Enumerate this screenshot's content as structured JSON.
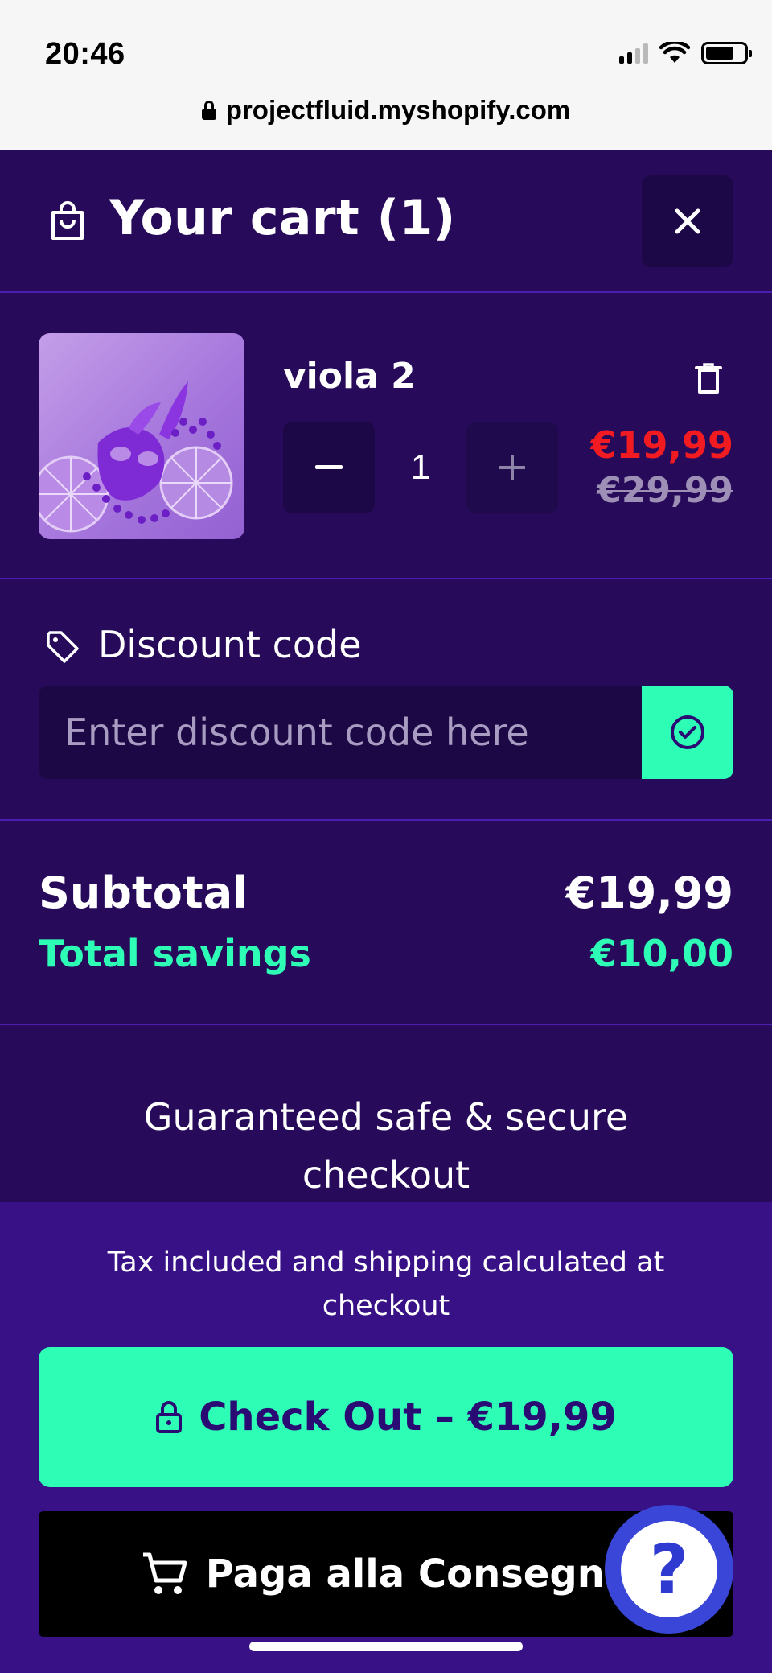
{
  "status_bar": {
    "time": "20:46"
  },
  "browser": {
    "url": "projectfluid.myshopify.com"
  },
  "cart": {
    "title": "Your cart (1)",
    "items": [
      {
        "name": "viola 2",
        "quantity": "1",
        "price": "€19,99",
        "compare_at_price": "€29,99"
      }
    ]
  },
  "discount": {
    "label": "Discount code",
    "placeholder": "Enter discount code here"
  },
  "totals": {
    "subtotal_label": "Subtotal",
    "subtotal_value": "€19,99",
    "savings_label": "Total savings",
    "savings_value": "€10,00"
  },
  "guarantee": "Guaranteed safe & secure checkout",
  "footer": {
    "tax_note": "Tax included and shipping calculated at checkout",
    "checkout_label": "Check Out – €19,99",
    "cod_label": "Paga alla Consegna"
  },
  "help": {
    "label": "?"
  },
  "colors": {
    "background": "#270a5a",
    "footer_background": "#371185",
    "accent": "#2efdb6",
    "sale_price": "#f21b21",
    "divider": "#4a1fb0",
    "help_button": "#3a46d8"
  },
  "icons": {
    "cart_header": "shopping-bag-icon",
    "close": "close-icon",
    "remove": "trash-icon",
    "decrease": "minus-icon",
    "increase": "plus-icon",
    "discount": "tag-icon",
    "apply": "check-circle-icon",
    "checkout": "lock-icon",
    "cod": "shopping-cart-icon",
    "help": "question-icon"
  }
}
